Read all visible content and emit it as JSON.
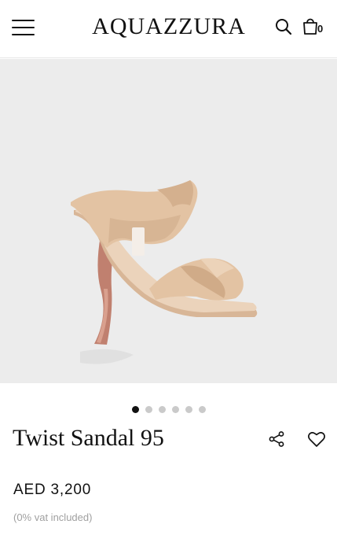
{
  "header": {
    "brand": "AQUAZZURA",
    "bag_count": "0",
    "menu_icon": "hamburger-menu-icon",
    "search_icon": "search-icon",
    "bag_icon": "shopping-bag-icon"
  },
  "gallery": {
    "image_description_icon": "product-photo",
    "slide_count": 6,
    "active_slide": 1
  },
  "product": {
    "name": "Twist Sandal 95",
    "price": "AED 3,200",
    "vat_note": "(0% vat included)",
    "share_icon": "share-icon",
    "wishlist_icon": "heart-icon"
  },
  "colors": {
    "gallery_bg": "#ececec",
    "text": "#111111",
    "muted": "#a0a0a0",
    "dot_active": "#111111",
    "dot_inactive": "#cacaca",
    "leather": "#e3c3a3",
    "heel": "#c0806f"
  }
}
